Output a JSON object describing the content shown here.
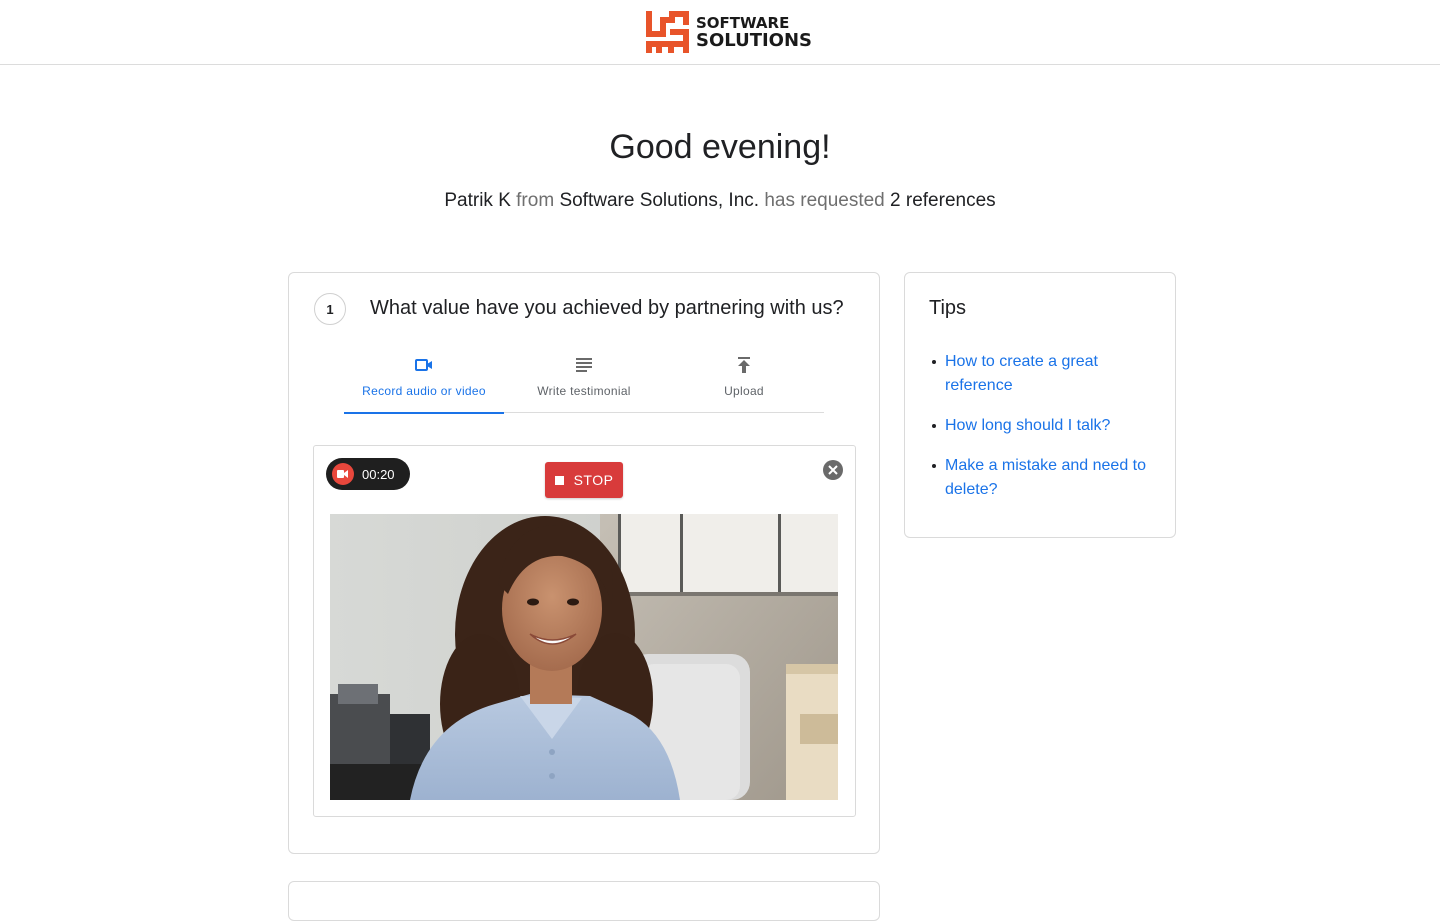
{
  "brand": {
    "line1": "SOFTWARE",
    "line2": "SOLUTIONS",
    "accent": "#e8542a"
  },
  "greeting": "Good evening!",
  "request": {
    "requester": "Patrik K",
    "from_word": "from",
    "company": "Software Solutions, Inc.",
    "has_requested": "has requested",
    "count_text": "2 references"
  },
  "question": {
    "number": "1",
    "text": "What value have you achieved by partnering with us?",
    "tabs": [
      {
        "label": "Record audio or video",
        "icon": "video-camera-icon",
        "active": true
      },
      {
        "label": "Write testimonial",
        "icon": "text-lines-icon",
        "active": false
      },
      {
        "label": "Upload",
        "icon": "upload-icon",
        "active": false
      }
    ]
  },
  "recorder": {
    "timer": "00:20",
    "stop_label": "STOP",
    "record_color": "#e8473c",
    "stop_color": "#d83b3b"
  },
  "tips": {
    "title": "Tips",
    "items": [
      "How to create a great reference",
      "How long should I talk?",
      "Make a mistake and need to delete?"
    ]
  },
  "colors": {
    "link": "#1a73e8",
    "muted_text": "#6f6f6f"
  }
}
